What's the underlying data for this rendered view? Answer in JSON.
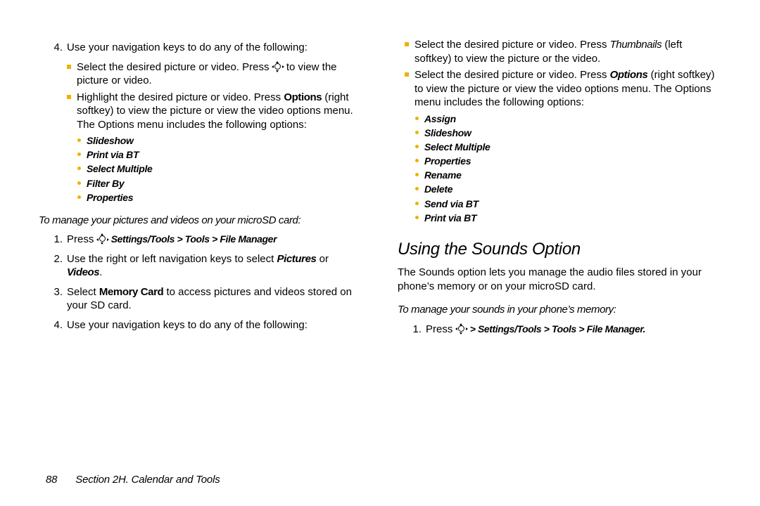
{
  "left": {
    "step4_pre": "Use your navigation keys to do any of the following:",
    "sub1_a": "Select the desired picture or video. Press ",
    "sub1_b": " to view the picture or video.",
    "sub2_a": "Highlight the desired picture or video. Press ",
    "sub2_opt": "Options",
    "sub2_b": " (right softkey) to view the picture or view the video options menu. The Options menu includes the following options:",
    "opts1": [
      "Slideshow",
      "Print via BT",
      "Select Multiple",
      "Filter By",
      "Properties"
    ],
    "subhead": "To manage your pictures and videos on your microSD card:",
    "s1_a": "Press ",
    "s1_b": "Settings/Tools > Tools > File Manager",
    "s2_a": "Use the right or left navigation keys to select ",
    "s2_b": "Pictures",
    "s2_c": " or ",
    "s2_d": "Videos",
    "s2_e": ".",
    "s3_a": "Select ",
    "s3_b": "Memory Card",
    "s3_c": " to access pictures and videos stored on your SD card.",
    "s4": "Use your navigation keys to do any of the following:"
  },
  "right": {
    "sub1_a": "Select the desired picture or video. Press ",
    "sub1_b": "Thumbnails",
    "sub1_c": " (left softkey) to view the picture or the video.",
    "sub2_a": "Select the desired picture or video. Press ",
    "sub2_b": "Options",
    "sub2_c": " (right softkey) to view the picture or view the video options menu. The Options menu includes the following options:",
    "opts2": [
      "Assign",
      "Slideshow",
      "Select Multiple",
      "Properties",
      "Rename",
      "Delete",
      "Send via BT",
      "Print via BT"
    ],
    "heading": "Using the Sounds Option",
    "para": "The Sounds option lets you manage the audio files stored in your phone’s memory or on your microSD card.",
    "subhead": "To manage your sounds in your phone’s memory:",
    "s1_a": "Press ",
    "s1_b": " > Settings/Tools > Tools > File Manager."
  },
  "footer": {
    "page": "88",
    "section": "Section 2H. Calendar and Tools"
  }
}
